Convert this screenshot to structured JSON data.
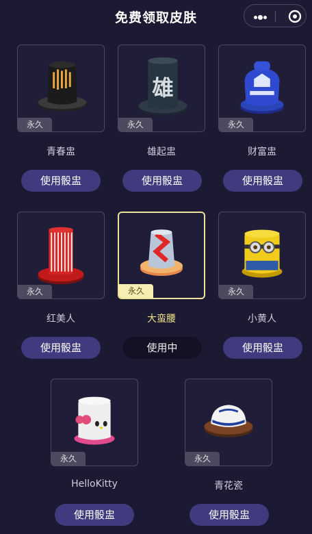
{
  "header": {
    "title": "免费领取皮肤"
  },
  "skins": [
    {
      "name": "青春盅",
      "badge": "永久",
      "button": "使用骰盅"
    },
    {
      "name": "雄起盅",
      "badge": "永久",
      "button": "使用骰盅",
      "art_text": "雄"
    },
    {
      "name": "财富盅",
      "badge": "永久",
      "button": "使用骰盅"
    },
    {
      "name": "红美人",
      "badge": "永久",
      "button": "使用骰盅"
    },
    {
      "name": "大蛮腰",
      "badge": "永久",
      "button": "使用中",
      "selected": true
    },
    {
      "name": "小黄人",
      "badge": "永久",
      "button": "使用骰盅"
    },
    {
      "name": "HelloKitty",
      "badge": "永久",
      "button": "使用骰盅"
    },
    {
      "name": "青花瓷",
      "badge": "永久",
      "button": "使用骰盅"
    }
  ],
  "colors": {
    "background": "#1c1a33",
    "button": "#403a7e",
    "selected": "#efe39a"
  }
}
